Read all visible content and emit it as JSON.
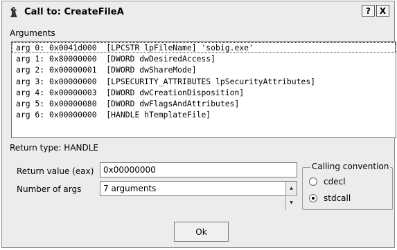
{
  "window": {
    "title": "Call to: CreateFileA",
    "help_label": "?",
    "close_label": "X"
  },
  "arguments_label": "Arguments",
  "arguments": [
    "arg 0: 0x0041d000  [LPCSTR lpFileName] 'sobig.exe'",
    "arg 1: 0x80000000  [DWORD dwDesiredAccess]",
    "arg 2: 0x00000001  [DWORD dwShareMode]",
    "arg 3: 0x00000000  [LPSECURITY_ATTRIBUTES lpSecurityAttributes]",
    "arg 4: 0x00000003  [DWORD dwCreationDisposition]",
    "arg 5: 0x00000080  [DWORD dwFlagsAndAttributes]",
    "arg 6: 0x00000000  [HANDLE hTemplateFile]"
  ],
  "return_type_label": "Return type: HANDLE",
  "return_value": {
    "label": "Return value (eax)",
    "value": "0x00000000"
  },
  "num_args": {
    "label": "Number of args",
    "value": "7 arguments",
    "up_glyph": "▲",
    "down_glyph": "▼"
  },
  "calling_convention": {
    "title": "Calling convention",
    "options": [
      {
        "label": "cdecl",
        "selected": false
      },
      {
        "label": "stdcall",
        "selected": true
      }
    ]
  },
  "ok_label": "Ok",
  "icon_name": "debugger-icon"
}
